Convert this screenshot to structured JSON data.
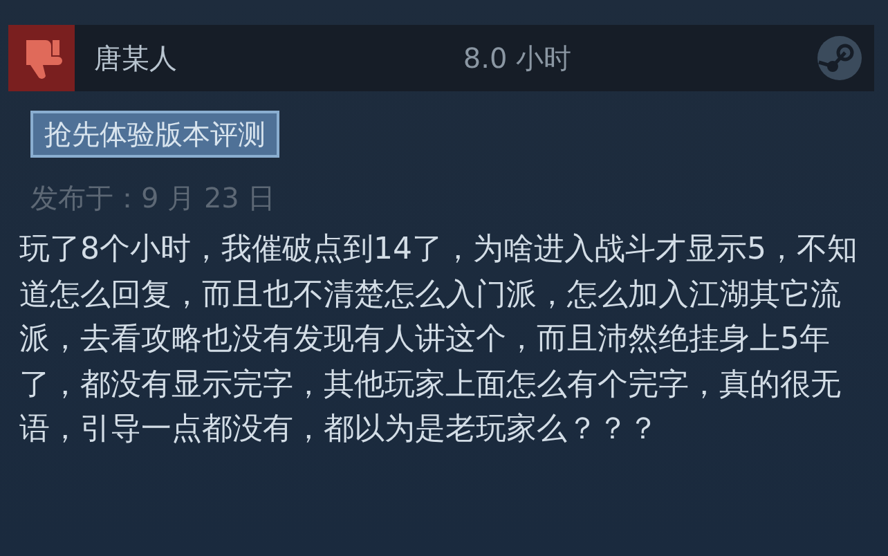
{
  "review": {
    "author": "唐某人",
    "recommended": false,
    "hours": "8.0 小时",
    "badge": "抢先体验版本评测",
    "posted": "发布于：9 月 23 日",
    "text": "玩了8个小时，我催破点到14了，为啥进入战斗才显示5，不知道怎么回复，而且也不清楚怎么入门派，怎么加入江湖其它流派，去看攻略也没有发现有人讲这个，而且沛然绝挂身上5年了，都没有显示完字，其他玩家上面怎么有个完字，真的很无语，引导一点都没有，都以为是老玩家么？？？"
  }
}
